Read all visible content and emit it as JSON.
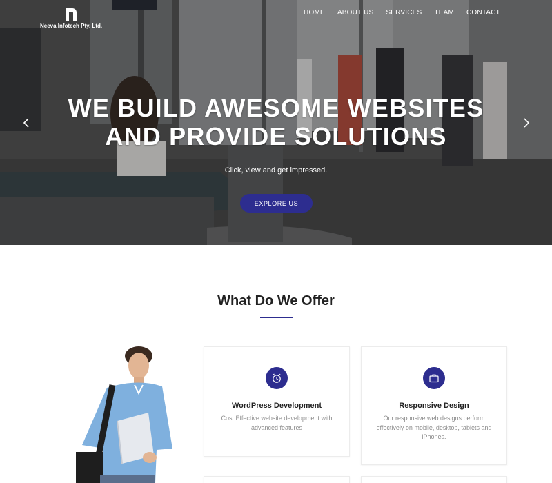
{
  "brand": {
    "name": "Neeva Infotech Pty. Ltd.",
    "logo_letter": "n"
  },
  "nav": {
    "items": [
      "HOME",
      "ABOUT US",
      "SERVICES",
      "TEAM",
      "CONTACT"
    ]
  },
  "hero": {
    "title_line1": "WE BUILD AWESOME WEBSITES",
    "title_line2": "AND PROVIDE SOLUTIONS",
    "subtitle": "Click, view and get impressed.",
    "cta_label": "EXPLORE US"
  },
  "offer": {
    "title": "What Do We Offer",
    "cards": [
      {
        "title": "WordPress Development",
        "description": "Cost Effective website development with advanced features",
        "icon": "alarm-clock-icon"
      },
      {
        "title": "Responsive Design",
        "description": "Our responsive web designs perform effectively on mobile, desktop, tablets and iPhones.",
        "icon": "briefcase-icon"
      }
    ]
  },
  "colors": {
    "accent": "#2d2d8f",
    "text_dark": "#222222",
    "text_muted": "#8c8c8c"
  }
}
